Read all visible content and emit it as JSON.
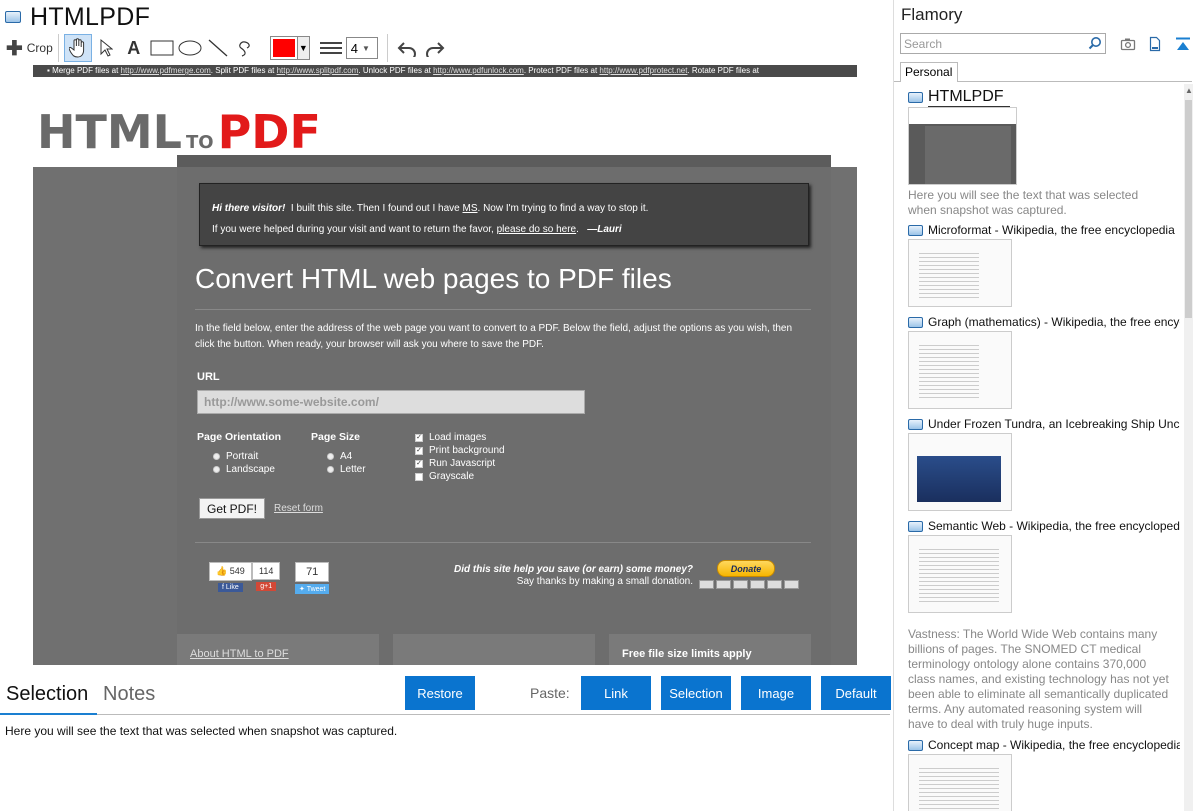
{
  "window": {
    "title": "HTMLPDF"
  },
  "toolbar": {
    "crop_label": "Crop",
    "color": "#ff0000",
    "size_value": "4"
  },
  "page": {
    "topbar_parts": [
      "Merge PDF files at ",
      "http://www.pdfmerge.com",
      ". Split PDF files at ",
      "http://www.splitpdf.com",
      ". Unlock PDF files at ",
      "http://www.pdfunlock.com",
      ". Protect PDF files at ",
      "http://www.pdfprotect.net",
      ". Rotate PDF files at"
    ],
    "logo": {
      "html": "HTML",
      "to": "TO",
      "pdf": "PDF"
    },
    "notice": {
      "greet": "Hi there visitor!",
      "line1a": "I built this site.  Then I found out I have ",
      "ms": "MS",
      "line1b": ".  Now I'm trying to find a way to stop it.",
      "line2a": "If you were helped during your visit and want to return the favor, ",
      "link": "please do so here",
      "line2b": ".",
      "sign": "—Lauri"
    },
    "heading": "Convert HTML web pages to PDF files",
    "intro": "In the field below, enter the address of the web page you want to convert to a PDF. Below the field, adjust the options as you wish, then click the button. When ready, your browser will ask you where to save the PDF.",
    "url_label": "URL",
    "url_placeholder": "http://www.some-website.com/",
    "orientation": {
      "head": "Page Orientation",
      "options": [
        "Portrait",
        "Landscape"
      ]
    },
    "page_size": {
      "head": "Page Size",
      "options": [
        "A4",
        "Letter"
      ]
    },
    "checks": [
      "Load images",
      "Print background",
      "Run Javascript",
      "Grayscale"
    ],
    "get_pdf": "Get PDF!",
    "reset": "Reset form",
    "social": {
      "like_count": "549",
      "like": "Like",
      "gplus_count": "114",
      "gplus": "+1",
      "tweet_count": "71",
      "tweet": "Tweet"
    },
    "donate_q": "Did this site help you save (or earn) some money?",
    "donate_s": "Say thanks by making a small donation.",
    "donate_btn": "Donate",
    "bottom_boxes": [
      "About HTML to PDF",
      "",
      "Free file size limits apply"
    ]
  },
  "bottom": {
    "tab_selection": "Selection",
    "tab_notes": "Notes",
    "restore": "Restore",
    "paste_label": "Paste:",
    "paste_link": "Link",
    "paste_selection": "Selection",
    "paste_image": "Image",
    "paste_default": "Default",
    "notes_text": "Here you will see the text that was selected when snapshot was captured."
  },
  "sidebar": {
    "app_name": "Flamory",
    "search_placeholder": "Search",
    "tab": "Personal",
    "items": [
      {
        "title": "HTMLPDF",
        "desc": "Here you will see the text that was selected when snapshot was captured."
      },
      {
        "title": "Microformat - Wikipedia, the free encyclopedia",
        "desc": ""
      },
      {
        "title": "Graph (mathematics) - Wikipedia, the free encyclopedia",
        "desc": ""
      },
      {
        "title": "Under Frozen Tundra, an Icebreaking Ship Uncovers",
        "desc": ""
      },
      {
        "title": "Semantic Web - Wikipedia, the free encyclopedia",
        "desc": "Vastness: The World Wide Web contains many billions of pages. The SNOMED CT medical terminology ontology alone contains 370,000 class names, and existing technology has not yet been able to eliminate all semantically duplicated terms. Any automated reasoning system will have to deal with truly huge inputs."
      },
      {
        "title": "Concept map - Wikipedia, the free encyclopedia",
        "desc": ""
      }
    ]
  }
}
